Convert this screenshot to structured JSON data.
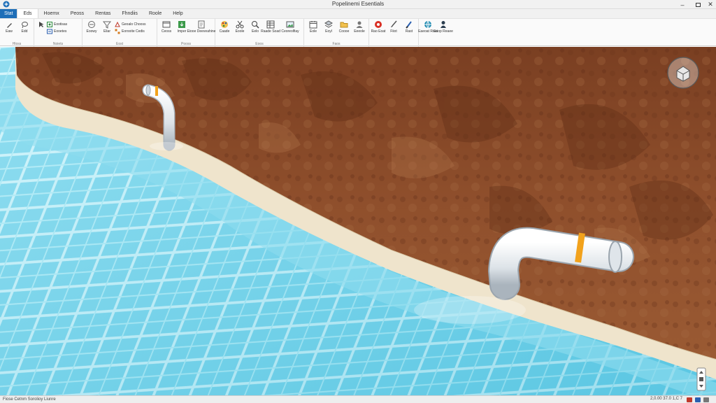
{
  "window": {
    "title": "Popelinemi Esentials"
  },
  "tabs": [
    {
      "label": "Stat",
      "active": false,
      "file": true
    },
    {
      "label": "Eds",
      "active": true
    },
    {
      "label": "Hoemx"
    },
    {
      "label": "Peoss"
    },
    {
      "label": "Rentas"
    },
    {
      "label": "Fhndiis"
    },
    {
      "label": "Roole"
    },
    {
      "label": "Help"
    }
  ],
  "ribbon": {
    "groups": [
      {
        "label": "Hloss",
        "buttons": [
          "Eaw",
          "Edd"
        ]
      },
      {
        "label": "Noiets",
        "small": [
          "Eootisas",
          "Eooetes"
        ]
      },
      {
        "label": "Eost",
        "buttons": [
          "Eoowy",
          "Eliar"
        ],
        "small": [
          "Geoalo Chooss",
          "Eorooite Cedis"
        ]
      },
      {
        "label": "Pooss",
        "buttons": [
          "Ceoss",
          "Imper",
          "Eiooe Deeveahine"
        ]
      },
      {
        "label": "Eoos",
        "buttons": [
          "Caade",
          "Eoole",
          "Eelo",
          "Raade Soad",
          "Ceoreolfiay"
        ]
      },
      {
        "label": "Faos",
        "buttons": [
          "Eole",
          "Eoyl",
          "Coooe",
          "Eeeole"
        ]
      },
      {
        "label": "",
        "buttons": [
          "Rao Eoat",
          "Fiiot",
          "Rast"
        ]
      },
      {
        "label": "",
        "buttons": [
          "Eaeoat Roat",
          "Eaop Reaee"
        ]
      }
    ]
  },
  "status": {
    "left": "Fiose Cetnm  Sorolioy Liunre",
    "right": "2,0.00 37.0 1,C 7"
  },
  "colors": {
    "water": "#6bd2ea",
    "sand": "#efe4cc",
    "soil": "#8a4a2a",
    "accent": "#1f6fb8",
    "pipe": "#e8ecef",
    "band": "#f2a21c"
  }
}
